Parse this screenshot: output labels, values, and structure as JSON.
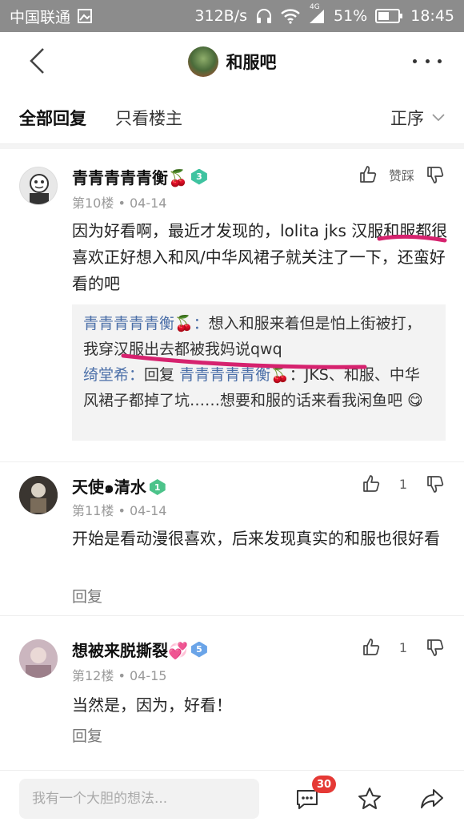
{
  "status_bar": {
    "carrier": "中国联通",
    "speed": "312B/s",
    "network": "4G",
    "battery": "51%",
    "time": "18:45"
  },
  "header": {
    "title": "和服吧"
  },
  "tabs": {
    "all_replies": "全部回复",
    "only_op": "只看楼主",
    "sort": "正序"
  },
  "posts": [
    {
      "username": "青青青青青衡🍒",
      "level": "3",
      "floor": "第10楼",
      "date": "04-14",
      "text": "因为好看啊，最近才发现的，lolita jks 汉服和服都很喜欢正好想入和风/中华风裙子就关注了一下，还蛮好看的吧",
      "like_label": "赞踩",
      "quotes": [
        {
          "name": "青青青青青衡🍒：",
          "text": "想入和服来着但是怕上街被打，我穿汉服出去都被我妈说qwq"
        },
        {
          "name": "绮堂希：",
          "mid": "回复 ",
          "reply_to": "青青青青青衡🍒",
          "text": "：JKS、和服、中华风裙子都掉了坑……想要和服的话来看我闲鱼吧 😋"
        }
      ]
    },
    {
      "username": "天使๑清水",
      "level": "1",
      "floor": "第11楼",
      "date": "04-14",
      "text": "开始是看动漫很喜欢，后来发现真实的和服也很好看",
      "like_count": "1",
      "reply_label": "回复"
    },
    {
      "username": "想被来脱撕裂💞",
      "level": "5",
      "floor": "第12楼",
      "date": "04-15",
      "text": "当然是，因为，好看！",
      "like_count": "1",
      "reply_label": "回复"
    }
  ],
  "bottom_bar": {
    "placeholder": "我有一个大胆的想法...",
    "comment_count": "30"
  },
  "colors": {
    "badge_level_3": "#3fc3a0",
    "badge_level_1": "#4cc38a",
    "badge_level_5": "#6aa4e8",
    "quote_name": "#4b6fa8",
    "notif": "#e53935",
    "annotation": "#d6226e"
  }
}
